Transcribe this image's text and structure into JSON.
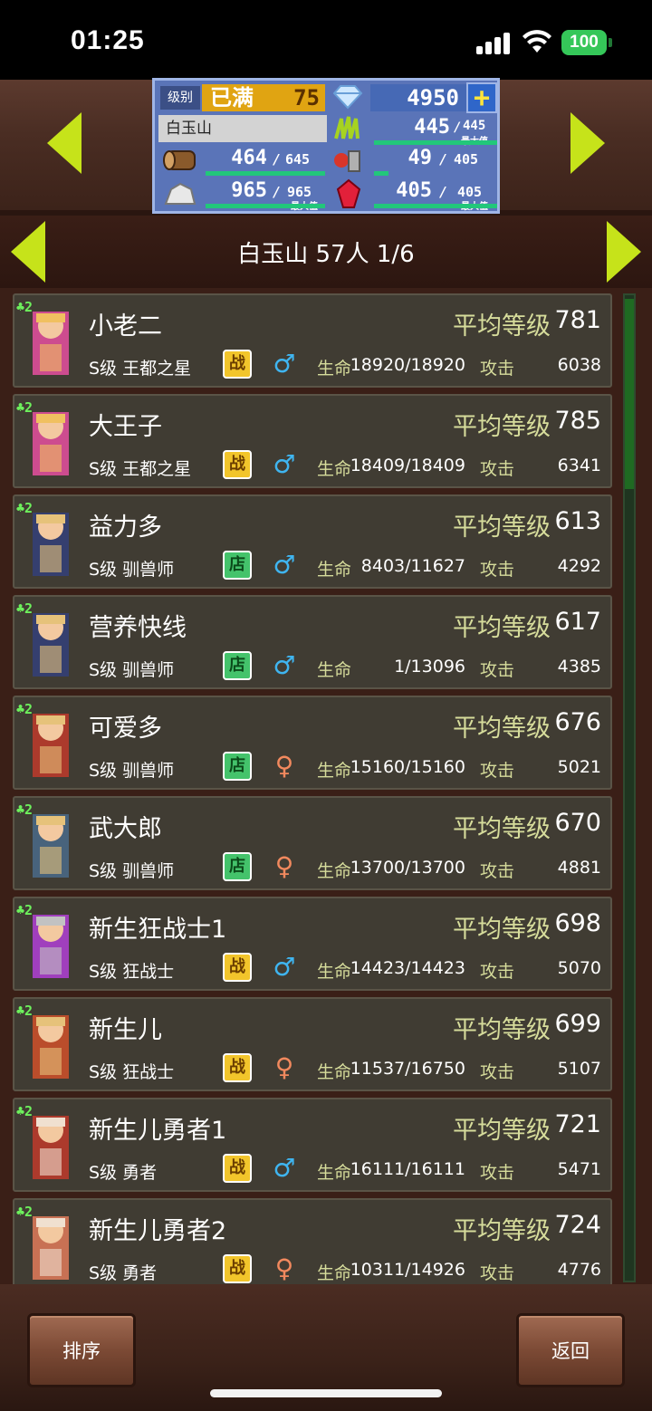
{
  "status": {
    "time": "01:25",
    "battery": "100"
  },
  "header": {
    "level_label": "级别",
    "level_status": "已满",
    "level_value": "75",
    "gems": "4950",
    "location": "白玉山",
    "grass": "445",
    "grass_max": "445",
    "grass_max_label": "最大值",
    "wood": "464",
    "wood_max": "645",
    "food": "49",
    "food_max": "405",
    "stone": "965",
    "stone_max": "965",
    "stone_max_label": "最大值",
    "ruby": "405",
    "ruby_max": "405",
    "ruby_max_label": "最大值"
  },
  "titlebar": {
    "text": "白玉山  57人  1/6"
  },
  "labels": {
    "avg_level": "平均等级",
    "hp": "生命",
    "atk": "攻击"
  },
  "rows": [
    {
      "name": "小老二",
      "level": "781",
      "job": "S级 王都之星",
      "tag": "战",
      "tag_type": "war",
      "sex": "m",
      "hp": "18920/18920",
      "atk": "6038",
      "rank": "2"
    },
    {
      "name": "大王子",
      "level": "785",
      "job": "S级 王都之星",
      "tag": "战",
      "tag_type": "war",
      "sex": "m",
      "hp": "18409/18409",
      "atk": "6341",
      "rank": "2"
    },
    {
      "name": "益力多",
      "level": "613",
      "job": "S级 驯兽师",
      "tag": "店",
      "tag_type": "shop",
      "sex": "m",
      "hp": "8403/11627",
      "atk": "4292",
      "rank": "2"
    },
    {
      "name": "营养快线",
      "level": "617",
      "job": "S级 驯兽师",
      "tag": "店",
      "tag_type": "shop",
      "sex": "m",
      "hp": "1/13096",
      "atk": "4385",
      "rank": "2"
    },
    {
      "name": "可爱多",
      "level": "676",
      "job": "S级 驯兽师",
      "tag": "店",
      "tag_type": "shop",
      "sex": "f",
      "hp": "15160/15160",
      "atk": "5021",
      "rank": "2"
    },
    {
      "name": "武大郎",
      "level": "670",
      "job": "S级 驯兽师",
      "tag": "店",
      "tag_type": "shop",
      "sex": "f",
      "hp": "13700/13700",
      "atk": "4881",
      "rank": "2"
    },
    {
      "name": "新生狂战士1",
      "level": "698",
      "job": "S级 狂战士",
      "tag": "战",
      "tag_type": "war",
      "sex": "m",
      "hp": "14423/14423",
      "atk": "5070",
      "rank": "2"
    },
    {
      "name": "新生儿",
      "level": "699",
      "job": "S级 狂战士",
      "tag": "战",
      "tag_type": "war",
      "sex": "f",
      "hp": "11537/16750",
      "atk": "5107",
      "rank": "2"
    },
    {
      "name": "新生儿勇者1",
      "level": "721",
      "job": "S级 勇者",
      "tag": "战",
      "tag_type": "war",
      "sex": "m",
      "hp": "16111/16111",
      "atk": "5471",
      "rank": "2"
    },
    {
      "name": "新生儿勇者2",
      "level": "724",
      "job": "S级 勇者",
      "tag": "战",
      "tag_type": "war",
      "sex": "f",
      "hp": "10311/14926",
      "atk": "4776",
      "rank": "2"
    }
  ],
  "buttons": {
    "sort": "排序",
    "back": "返回"
  },
  "colors": {
    "accent_arrow": "#c6e31a",
    "row_bg": "#403c33",
    "bar_green": "#22c77a"
  }
}
